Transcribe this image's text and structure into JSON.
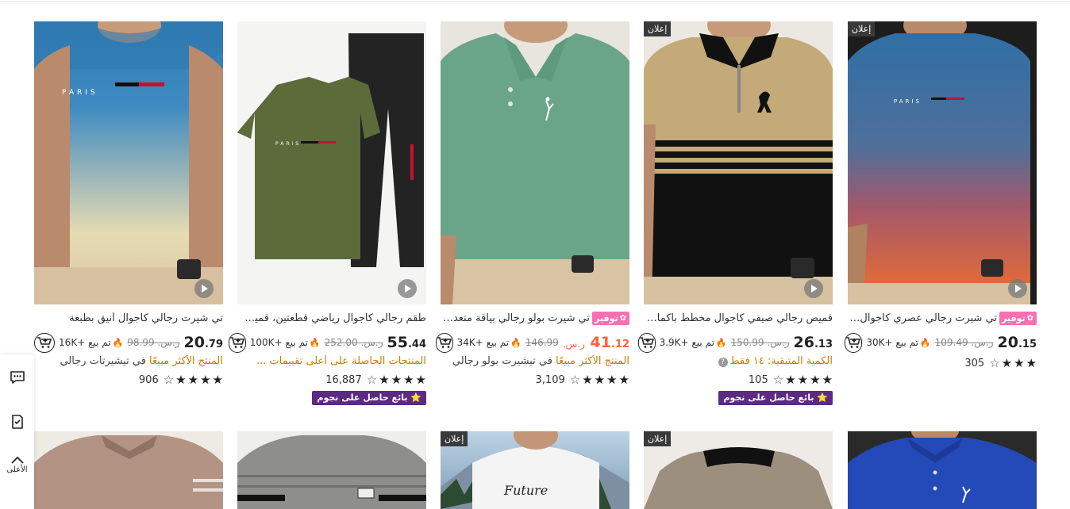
{
  "currency": "ر.س.",
  "ad_label": "إعلان",
  "save_label": "توفير",
  "seller_badge_label": "بائع حاصل على نجوم",
  "side_tools": {
    "top_label": "الأعلى"
  },
  "products": [
    {
      "title": "تي شيرت رجالي كاجوال أنيق بطبعة",
      "price_main": "20",
      "price_dec": ".79",
      "old_price": "98.99",
      "sold": "تم بيع +16K",
      "tag": "المنتج الأكثر مبيعًا",
      "tag_grey": " في تيشيرتات رجالي",
      "rating_count": "906",
      "stars": 4.5,
      "has_save": false,
      "is_ad": false,
      "has_seller_badge": false,
      "has_play": true,
      "sale_price": false
    },
    {
      "title": "طقم رجالي كاجوال رياضي قطعتين، قميص...",
      "price_main": "55",
      "price_dec": ".44",
      "old_price": "252.00",
      "sold": "تم بيع +100K",
      "tag": "المنتجات الحاصلة على أعلى تقييمات ...",
      "tag_grey": "",
      "rating_count": "16,887",
      "stars": 4.5,
      "has_save": false,
      "is_ad": false,
      "has_seller_badge": true,
      "has_play": true,
      "sale_price": false
    },
    {
      "title": "تي شيرت بولو رجالي بياقة متعدد...",
      "price_main": "41",
      "price_dec": ".12",
      "old_price": "146.99",
      "sold": "تم بيع +34K",
      "tag": "المنتج الأكثر مبيعًا",
      "tag_grey": " في تيشيرت بولو رجالي",
      "rating_count": "3,109",
      "stars": 4.5,
      "has_save": true,
      "is_ad": false,
      "has_seller_badge": false,
      "has_play": false,
      "sale_price": true
    },
    {
      "title": "قميص رجالي صيفي كاجوال مخطط بأكمام...",
      "price_main": "26",
      "price_dec": ".13",
      "old_price": "150.99",
      "sold": "تم بيع +3.9K",
      "tag": "الكمية المتبقية: ١٤ فقط",
      "tag_grey": "",
      "rating_count": "105",
      "stars": 4.5,
      "has_save": false,
      "is_ad": true,
      "has_seller_badge": true,
      "has_play": true,
      "sale_price": false
    },
    {
      "title": "تي شيرت رجالي عصري كاجوال - ...",
      "price_main": "20",
      "price_dec": ".15",
      "old_price": "109.49",
      "sold": "تم بيع +30K",
      "tag": "",
      "tag_grey": "",
      "rating_count": "305",
      "stars": 3.5,
      "has_save": true,
      "is_ad": true,
      "has_seller_badge": false,
      "has_play": true,
      "sale_price": false
    }
  ],
  "second_row_ads": [
    false,
    false,
    true,
    true,
    false
  ]
}
